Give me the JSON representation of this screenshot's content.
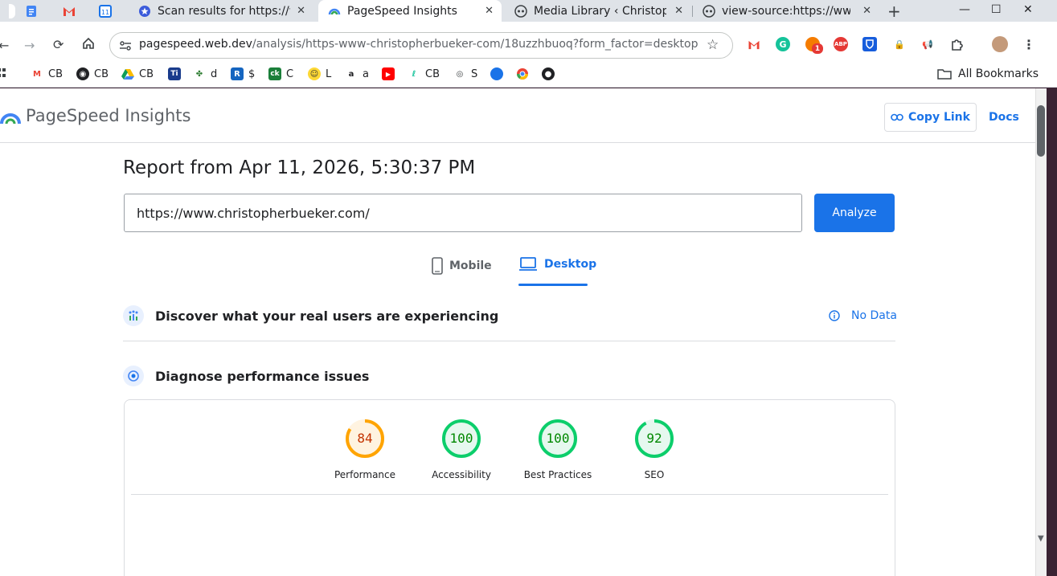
{
  "browser": {
    "tabs": [
      {
        "title": "Scan results for https://www.christopherbueker.com/",
        "icon": "scan-favicon",
        "close": "✕"
      },
      {
        "title": "PageSpeed Insights",
        "icon": "pagespeed-favicon",
        "close": "✕"
      },
      {
        "title": "Media Library ‹ Christopher Bueker",
        "icon": "wordpress-favicon",
        "close": "✕"
      },
      {
        "title": "view-source:https://www.christopherbueker.com/",
        "icon": "view-source-favicon",
        "close": "✕"
      }
    ],
    "new_tab": "+",
    "window_controls": {
      "minimize": "—",
      "maximize": "☐",
      "close": "✕"
    },
    "url": {
      "host": "pagespeed.web.dev",
      "path": "/analysis/https-www-christopherbueker-com/18uzzhbuoq?form_factor=desktop"
    },
    "extension_badge": "1",
    "bookmarks": [
      {
        "label": "CB"
      },
      {
        "label": "CB"
      },
      {
        "label": "CB"
      },
      {
        "label": ""
      },
      {
        "label": "d"
      },
      {
        "label": "$"
      },
      {
        "label": "C"
      },
      {
        "label": "L"
      },
      {
        "label": "a"
      },
      {
        "label": ""
      },
      {
        "label": "CB"
      },
      {
        "label": "S"
      },
      {
        "label": ""
      },
      {
        "label": ""
      },
      {
        "label": ""
      }
    ],
    "all_bookmarks": "All Bookmarks"
  },
  "psi": {
    "product_name": "PageSpeed Insights",
    "copy_link": "Copy Link",
    "docs": "Docs",
    "report_title": "Report from Apr 11, 2026, 5:30:37 PM",
    "url_value": "https://www.christopherbueker.com/",
    "analyze": "Analyze",
    "form_factors": {
      "mobile": "Mobile",
      "desktop": "Desktop",
      "selected": "desktop"
    },
    "real_users": {
      "heading": "Discover what your real users are experiencing",
      "status": "No Data"
    },
    "diagnose": {
      "heading": "Diagnose performance issues"
    },
    "scores": [
      {
        "label": "Performance",
        "score": 84,
        "color": "#ffa400",
        "bg": "#fff3e0",
        "text_color": "#c33300"
      },
      {
        "label": "Accessibility",
        "score": 100,
        "color": "#0cce6b",
        "bg": "#e6f8ef",
        "text_color": "#008800"
      },
      {
        "label": "Best Practices",
        "score": 100,
        "color": "#0cce6b",
        "bg": "#e6f8ef",
        "text_color": "#008800"
      },
      {
        "label": "SEO",
        "score": 92,
        "color": "#0cce6b",
        "bg": "#e6f8ef",
        "text_color": "#008800"
      }
    ]
  },
  "colors": {
    "accent": "#1a73e8"
  }
}
